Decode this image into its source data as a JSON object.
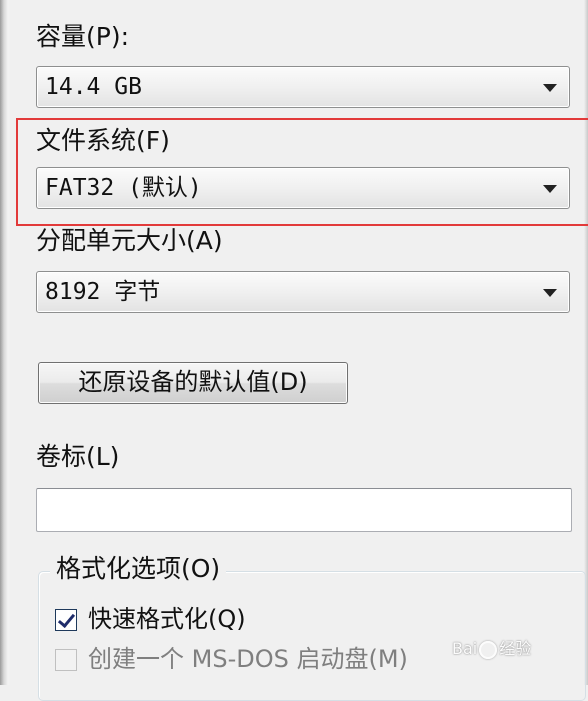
{
  "capacity": {
    "label": "容量(P):",
    "value": "14.4 GB"
  },
  "file_system": {
    "label": "文件系统(F)",
    "value": "FAT32 (默认)"
  },
  "allocation_unit": {
    "label": "分配单元大小(A)",
    "value": "8192 字节"
  },
  "restore_defaults_button": "还原设备的默认值(D)",
  "volume_label": {
    "label": "卷标(L)",
    "value": ""
  },
  "format_options": {
    "title": "格式化选项(O)",
    "quick_format": {
      "label": "快速格式化(Q)",
      "checked": true
    },
    "ms_dos_boot": {
      "label": "创建一个 MS-DOS 启动盘(M)",
      "checked": false,
      "enabled": false
    }
  },
  "watermark": {
    "left_text": "Bai",
    "right_text": "经验"
  },
  "colors": {
    "highlight": "#e23a3a",
    "background": "#f0f0f0"
  }
}
